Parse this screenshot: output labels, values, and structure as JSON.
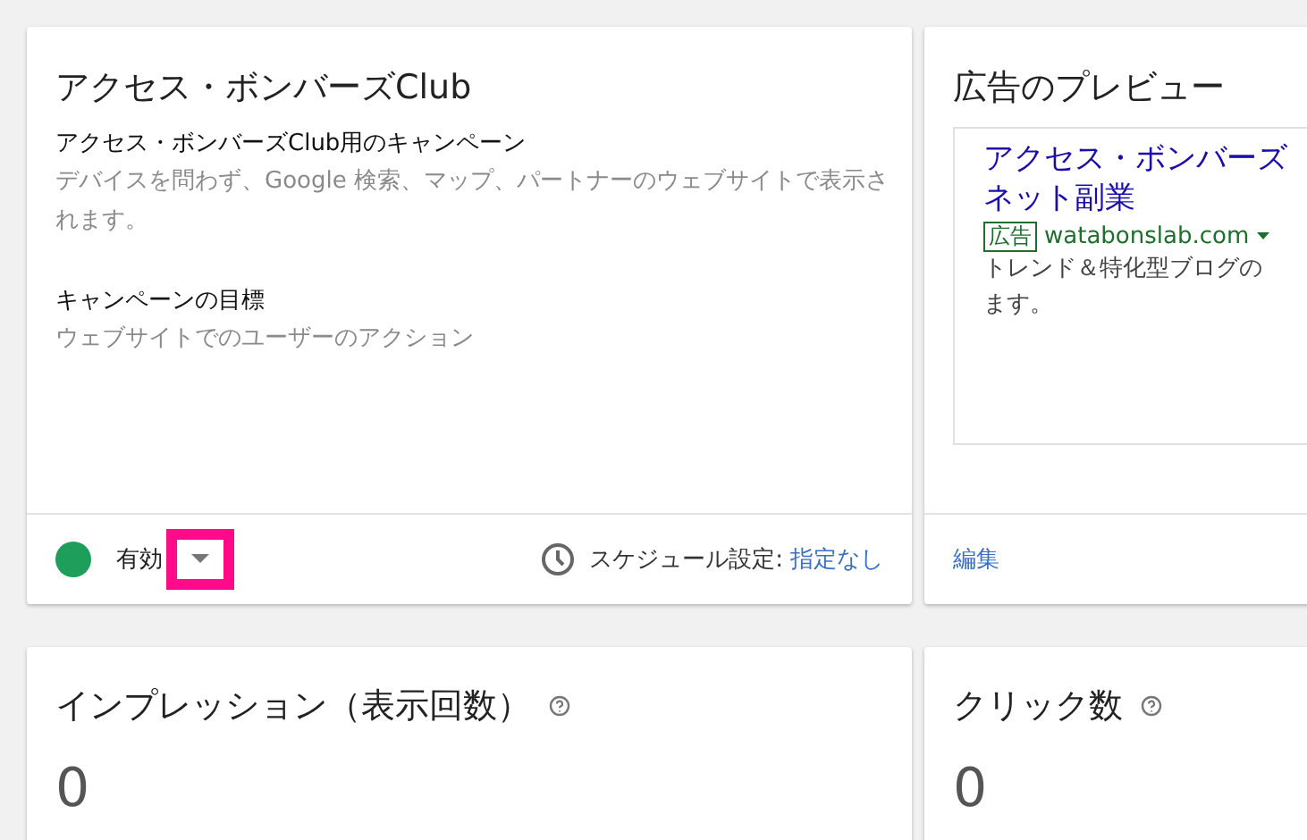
{
  "campaign_card": {
    "title": "アクセス・ボンバーズClub",
    "sections": [
      {
        "heading": "アクセス・ボンバーズClub用のキャンペーン",
        "text": "デバイスを問わず、Google 検索、マップ、パートナーのウェブサイトで表示されます。"
      },
      {
        "heading": "キャンペーンの目標",
        "text": "ウェブサイトでのユーザーのアクション"
      }
    ],
    "status": {
      "label": "有効",
      "color": "#1e9e5a",
      "dropdown_highlighted": true
    },
    "schedule": {
      "label": "スケジュール設定:",
      "value": "指定なし"
    }
  },
  "ad_preview_card": {
    "title": "広告のプレビュー",
    "ad": {
      "headline_1": "アクセス・ボンバーズ",
      "headline_2": "ネット副業",
      "badge": "広告",
      "url": "watabonslab.com",
      "description_1": "トレンド＆特化型ブログの",
      "description_2": "ます。"
    },
    "edit_link": "編集"
  },
  "metrics": [
    {
      "label": "インプレッション（表示回数）",
      "value": "0"
    },
    {
      "label": "クリック数",
      "value": "0"
    }
  ]
}
